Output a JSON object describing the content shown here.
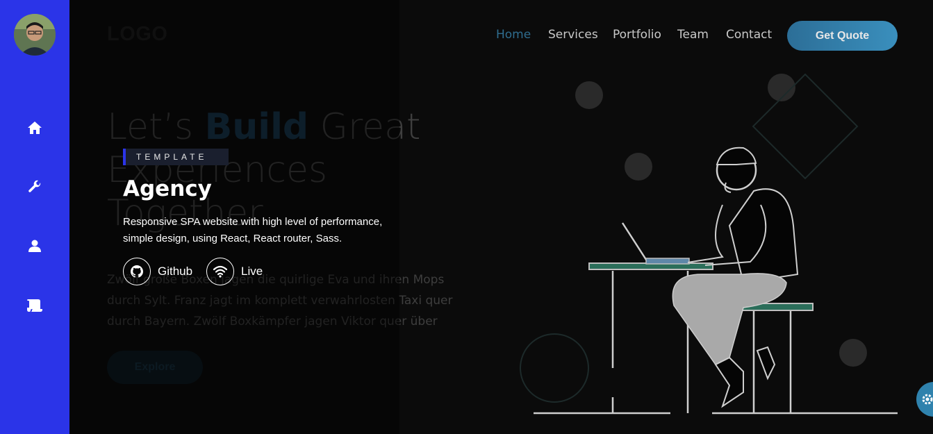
{
  "sidebar": {
    "items": [
      {
        "name": "home-icon"
      },
      {
        "name": "wrench-icon"
      },
      {
        "name": "user-icon"
      },
      {
        "name": "scroll-icon"
      }
    ],
    "accent": "#2b34e8"
  },
  "preview": {
    "logo": "LOGO",
    "nav": [
      "Home",
      "Services",
      "Portfolio",
      "Team",
      "Contact"
    ],
    "quote_button": "Get Quote",
    "hero": {
      "line1_a": "Let’s ",
      "line1_accent": "Build",
      "line1_b": " Great",
      "line2": "Experiences",
      "line3": "Together",
      "paragraph": "Zwölf große Boxen jagen die quirlige Eva und ihren Mops durch Sylt. Franz jagt im komplett verwahrlosten Taxi quer durch Bayern. Zwölf Boxkämpfer jagen Viktor quer über",
      "explore": "Explore"
    }
  },
  "project": {
    "tag": "TEMPLATE",
    "title": "Agency",
    "description": "Responsive SPA website with high level of performance, simple design, using React, React router, Sass.",
    "links": [
      {
        "label": "Github",
        "icon": "github-icon"
      },
      {
        "label": "Live",
        "icon": "wifi-icon"
      }
    ]
  },
  "colors": {
    "nav_active": "#2f6d8f",
    "quote": "#3a8fbd",
    "fab": "#2f82ad"
  }
}
